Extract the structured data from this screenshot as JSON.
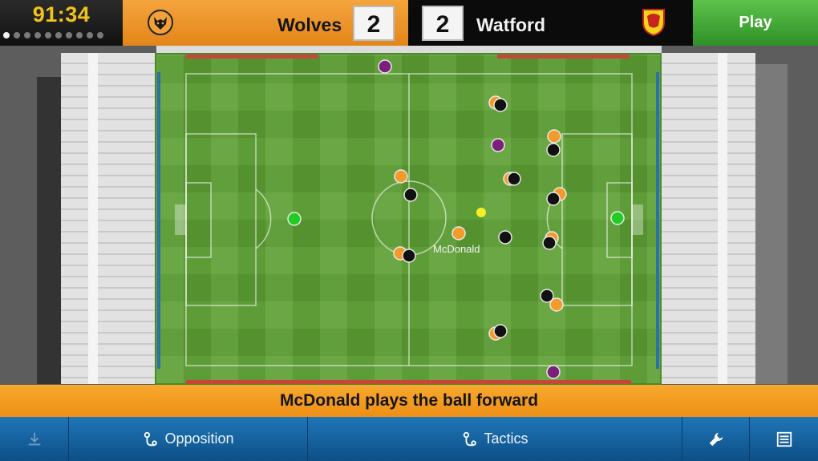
{
  "match": {
    "clock": "91:34",
    "home": {
      "name": "Wolves",
      "score": "2",
      "crest": "wolves-crest-icon",
      "color": "#f4a43c"
    },
    "away": {
      "name": "Watford",
      "score": "2",
      "crest": "watford-crest-icon",
      "color": "#0b0b0b"
    },
    "play_label": "Play",
    "pages": {
      "count": 10,
      "active": 0
    }
  },
  "pitch": {
    "highlighted_player": "McDonald",
    "colors": {
      "home": "#f29a2a",
      "away": "#111111",
      "keeper_home": "#22cc22",
      "officials": "#7a1f7a",
      "ball": "#f4f023"
    }
  },
  "commentary": {
    "text": "McDonald plays the ball forward"
  },
  "toolbar": {
    "download_icon": "download-icon",
    "opposition_label": "Opposition",
    "tactics_label": "Tactics",
    "settings_icon": "wrench-icon",
    "menu_icon": "list-icon"
  }
}
